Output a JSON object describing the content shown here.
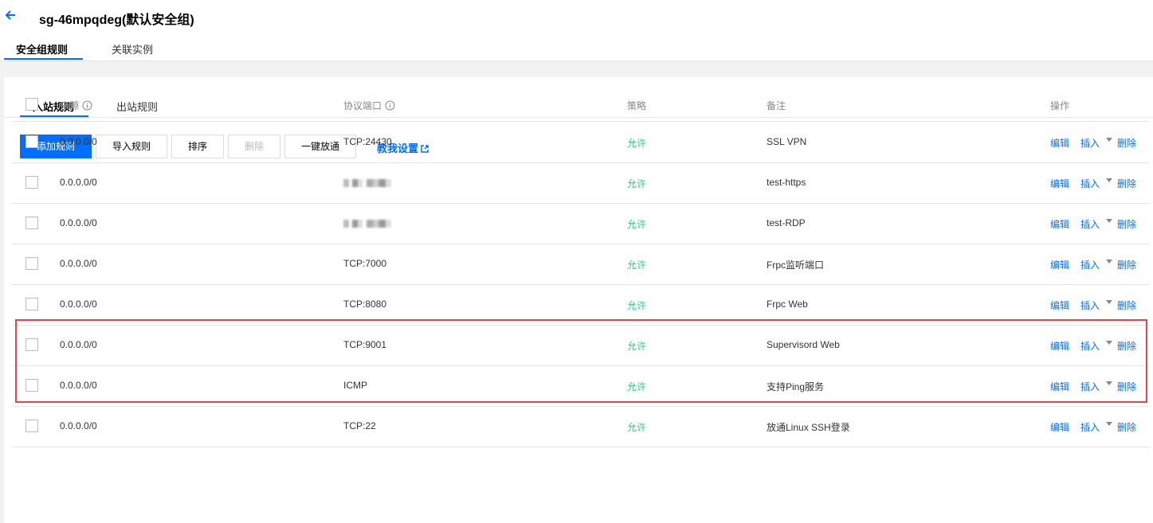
{
  "header": {
    "title": "sg-46mpqdeg(默认安全组)",
    "tabs": [
      {
        "label": "安全组规则",
        "active": true
      },
      {
        "label": "关联实例",
        "active": false
      }
    ]
  },
  "sub_tabs": [
    {
      "label": "入站规则",
      "active": true
    },
    {
      "label": "出站规则",
      "active": false
    }
  ],
  "toolbar": {
    "add_rule": "添加规则",
    "import_rule": "导入规则",
    "sort": "排序",
    "delete": "删除",
    "open_all": "一键放通",
    "help": "教我设置"
  },
  "table": {
    "columns": {
      "source": "来源",
      "protocol_port": "协议端口",
      "policy": "策略",
      "remark": "备注",
      "actions": "操作"
    },
    "row_actions": {
      "edit": "编辑",
      "insert": "插入",
      "delete": "删除"
    },
    "rows": [
      {
        "source": "0.0.0.0/0",
        "port": "TCP:24430",
        "port_blurred": false,
        "policy": "允许",
        "remark": "SSL VPN"
      },
      {
        "source": "0.0.0.0/0",
        "port": "",
        "port_blurred": true,
        "policy": "允许",
        "remark": "test-https"
      },
      {
        "source": "0.0.0.0/0",
        "port": "",
        "port_blurred": true,
        "policy": "允许",
        "remark": "test-RDP"
      },
      {
        "source": "0.0.0.0/0",
        "port": "TCP:7000",
        "port_blurred": false,
        "policy": "允许",
        "remark": "Frpc监听端口",
        "highlighted": true
      },
      {
        "source": "0.0.0.0/0",
        "port": "TCP:8080",
        "port_blurred": false,
        "policy": "允许",
        "remark": "Frpc Web",
        "highlighted": true
      },
      {
        "source": "0.0.0.0/0",
        "port": "TCP:9001",
        "port_blurred": false,
        "policy": "允许",
        "remark": "Supervisord Web"
      },
      {
        "source": "0.0.0.0/0",
        "port": "ICMP",
        "port_blurred": false,
        "policy": "允许",
        "remark": "支持Ping服务"
      },
      {
        "source": "0.0.0.0/0",
        "port": "TCP:22",
        "port_blurred": false,
        "policy": "允许",
        "remark": "放通Linux SSH登录"
      }
    ]
  },
  "colors": {
    "accent": "#006eff",
    "allow": "#29cc85",
    "highlight": "#e54545"
  }
}
